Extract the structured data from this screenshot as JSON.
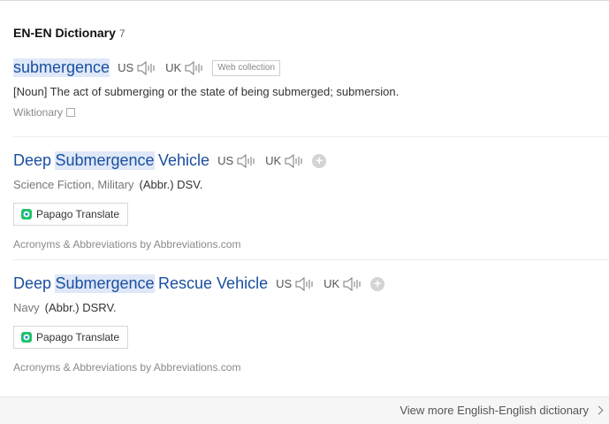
{
  "header": {
    "title": "EN-EN Dictionary",
    "count": "7"
  },
  "entries": [
    {
      "word": "submergence",
      "us_label": "US",
      "uk_label": "UK",
      "tag": "Web collection",
      "definition": "[Noun] The act of submerging or the state of being submerged; submersion.",
      "source": "Wiktionary"
    },
    {
      "word_part1": "Deep",
      "word_part2": "Submergence",
      "word_part3": "Vehicle",
      "us_label": "US",
      "uk_label": "UK",
      "category": "Science Fiction, Military",
      "abbr": "(Abbr.) DSV.",
      "papago": "Papago Translate",
      "source": "Acronyms & Abbreviations by Abbreviations.com"
    },
    {
      "word_part1": "Deep",
      "word_part2": "Submergence",
      "word_part3": "Rescue Vehicle",
      "us_label": "US",
      "uk_label": "UK",
      "category": "Navy",
      "abbr": "(Abbr.) DSRV.",
      "papago": "Papago Translate",
      "source": "Acronyms & Abbreviations by Abbreviations.com"
    }
  ],
  "footer": {
    "more": "View more English-English dictionary"
  },
  "colors": {
    "link": "#1a4fa0",
    "highlight": "#dfe8f8"
  }
}
